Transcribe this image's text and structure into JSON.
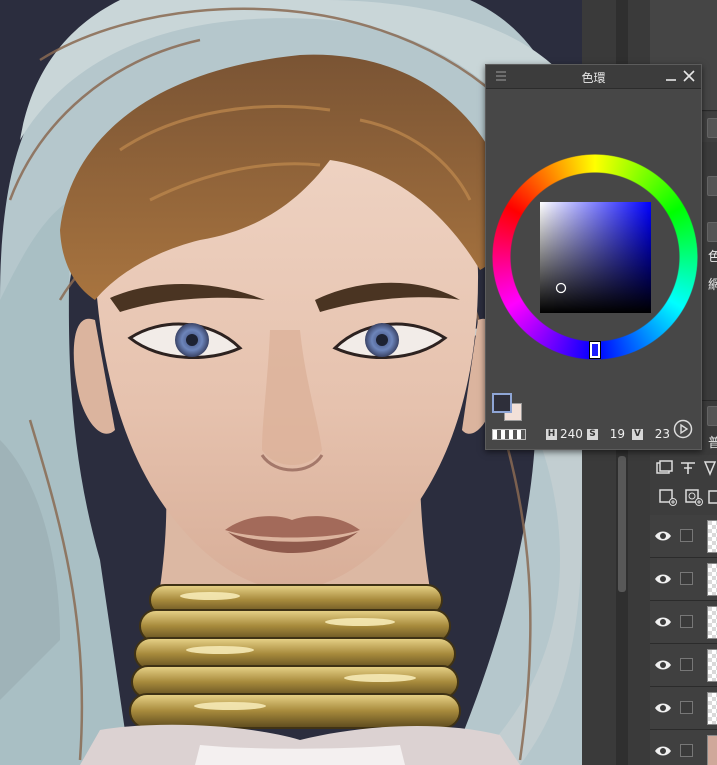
{
  "palette": {
    "title": "色環",
    "hsv": {
      "h_key": "H",
      "h_value": "240",
      "s_key": "S",
      "s_value": "19",
      "v_key": "V",
      "v_value": "23"
    },
    "foreground_color": "#2e2f3a",
    "background_color": "#f2e0d8"
  },
  "side_panel": {
    "label_color": "色",
    "label_grid": "網",
    "label_normal": "普"
  },
  "icons": {
    "palette_menu": "menu-icon",
    "minimize": "minimize-icon",
    "close": "close-icon",
    "mode": "play-circle-icon",
    "layer_visibility": "eye-icon"
  }
}
